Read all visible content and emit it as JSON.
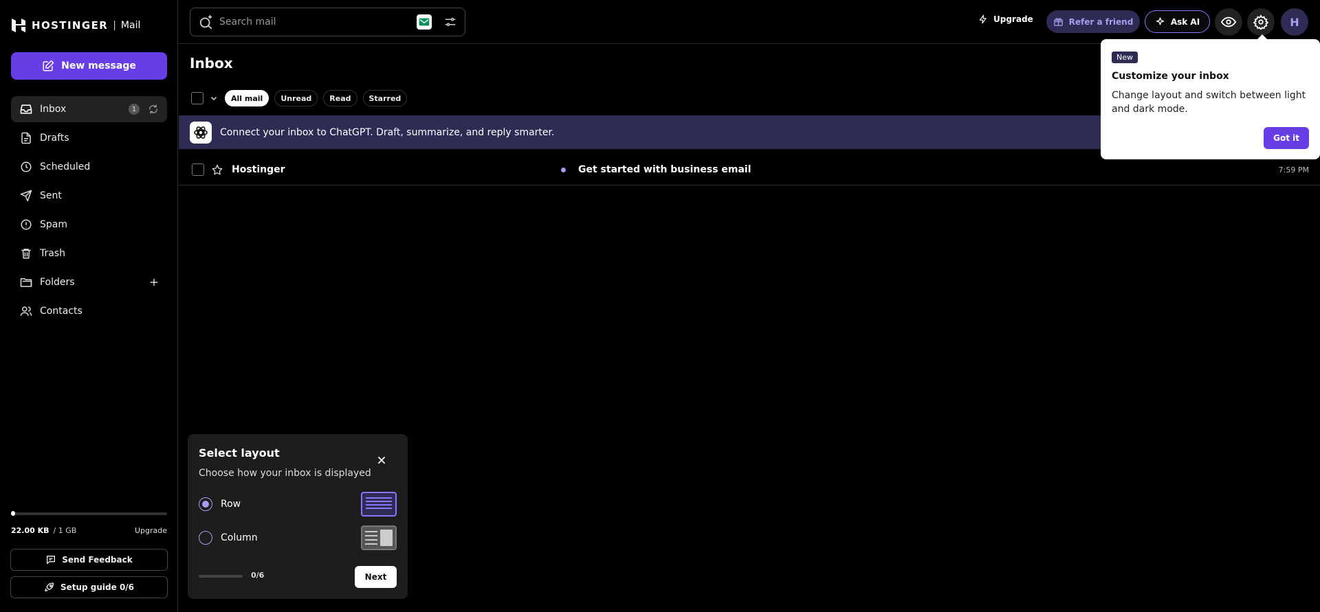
{
  "app": {
    "brand": "HOSTINGER",
    "separator": "|",
    "product": "Mail"
  },
  "sidebar": {
    "new_message_label": "New message",
    "items": [
      {
        "label": "Inbox",
        "badge": "1",
        "icon": "inbox-icon",
        "active": true
      },
      {
        "label": "Drafts",
        "icon": "draft-file-icon"
      },
      {
        "label": "Scheduled",
        "icon": "clock-icon"
      },
      {
        "label": "Sent",
        "icon": "send-icon"
      },
      {
        "label": "Spam",
        "icon": "spam-icon"
      },
      {
        "label": "Trash",
        "icon": "trash-icon"
      },
      {
        "label": "Folders",
        "icon": "folder-icon"
      },
      {
        "label": "Contacts",
        "icon": "contacts-icon"
      }
    ],
    "storage": {
      "used": "22.00 KB",
      "total": "/ 1 GB",
      "upgrade_label": "Upgrade",
      "used_fraction": 0.0
    },
    "feedback_label": "Send Feedback",
    "setup_label": "Setup guide 0/6"
  },
  "header": {
    "search_placeholder": "Search mail",
    "upgrade_label": "Upgrade",
    "refer_label": "Refer a friend",
    "ask_ai_label": "Ask AI",
    "avatar_initial": "H"
  },
  "main": {
    "title": "Inbox",
    "filters": [
      "All mail",
      "Unread",
      "Read",
      "Starred"
    ],
    "promo_text": "Connect your inbox to ChatGPT. Draft, summarize, and reply smarter.",
    "emails": [
      {
        "sender": "Hostinger",
        "subject": "Get started with business email",
        "time": "7:59 PM",
        "unread": true
      }
    ]
  },
  "popover": {
    "tag": "New",
    "title": "Customize your inbox",
    "body": "Change layout and switch between light and dark mode.",
    "button": "Got it"
  },
  "layout_panel": {
    "title": "Select layout",
    "subtitle": "Choose how your inbox is displayed",
    "options": [
      {
        "label": "Row",
        "selected": true
      },
      {
        "label": "Column",
        "selected": false
      }
    ],
    "progress": "0/6",
    "next_label": "Next"
  },
  "colors": {
    "accent": "#673de6",
    "accent_light": "#a79ef0",
    "promo_bg": "#2e2c54"
  }
}
